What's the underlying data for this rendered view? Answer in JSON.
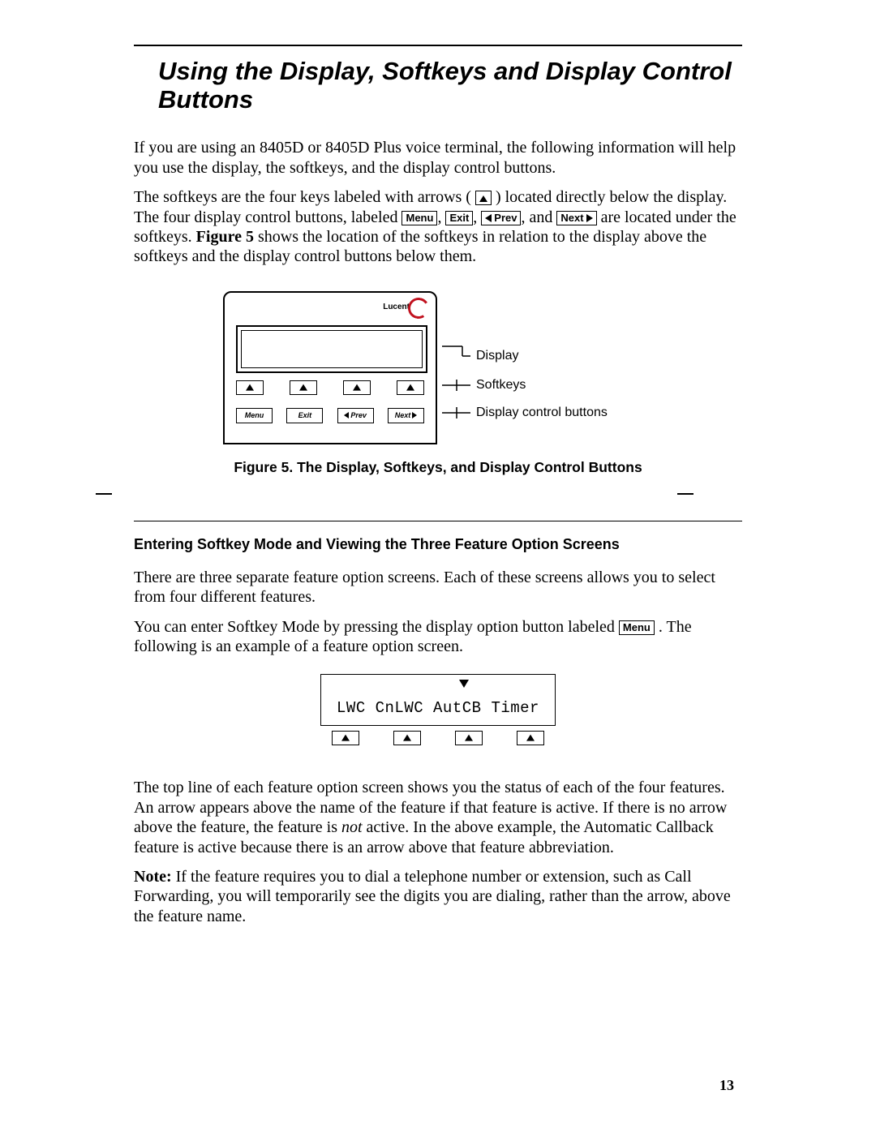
{
  "title": "Using the Display, Softkeys and Display Control Buttons",
  "para1": "If you are using an 8405D or 8405D Plus voice terminal, the following information will help you use the display, the softkeys, and the display control buttons.",
  "para2a": "The softkeys are the four keys labeled with arrows (",
  "para2b": ") located directly below the display. The four display control buttons, labeled ",
  "para2c": ", ",
  "para2d": ", ",
  "para2e": ", and ",
  "para2f": " are located under the softkeys. ",
  "para2g": "Figure 5",
  "para2h": " shows the location of the softkeys in relation to the display above the softkeys and the display control buttons below them.",
  "cap_menu": "Menu",
  "cap_exit": "Exit",
  "cap_prev": "Prev",
  "cap_next": "Next",
  "device_brand": "Lucent",
  "dbtn_menu": "Menu",
  "dbtn_exit": "Exit",
  "dbtn_prev": "Prev",
  "dbtn_next": "Next",
  "callout_display": "Display",
  "callout_softkeys": "Softkeys",
  "callout_ctrl": "Display control buttons",
  "fig_caption": "Figure 5.  The Display, Softkeys, and Display Control Buttons",
  "subhead": "Entering Softkey Mode and Viewing the Three Feature Option Screens",
  "para3": "There are three separate feature option screens. Each of these screens allows you to select from four different features.",
  "para4a": "You can enter Softkey Mode by pressing the display option button labeled ",
  "para4b": ". The following is an example of a feature option screen.",
  "opt_text": "LWC  CnLWC AutCB Timer",
  "para5a": "The top line of each feature option screen shows you the status of each of the four features. An arrow appears above the name of the feature if that feature is active. If there is no arrow above the feature, the feature is ",
  "para5b": "not",
  "para5c": " active. In the above example, the Automatic Callback feature is active because there is an arrow above that feature abbreviation.",
  "note_label": "Note:",
  "para6": "   If the feature requires you to dial a telephone number or extension, such as Call Forwarding, you will temporarily see the digits you are dialing, rather than the arrow, above the feature name.",
  "page_number": "13"
}
